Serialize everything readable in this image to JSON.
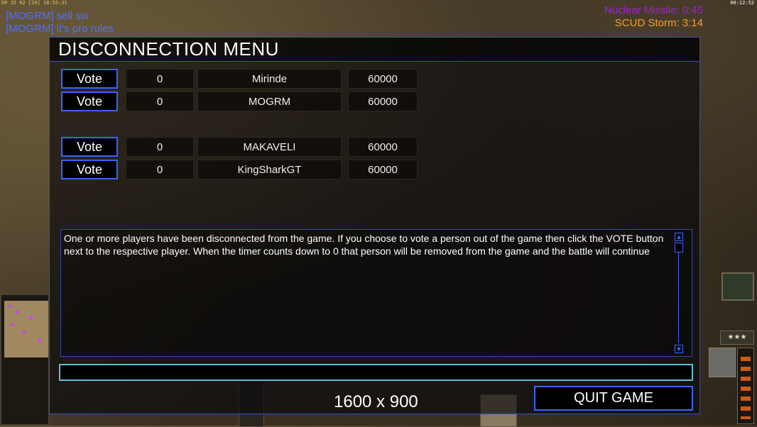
{
  "hud": {
    "top_left_stats": "DR 35 62 [20] 18:55:31",
    "top_right_clock": "00:12:52"
  },
  "chat": {
    "messages": [
      {
        "text": "[MOGRM] sell sw"
      },
      {
        "text": "[MOGRM] it's pro rules"
      }
    ]
  },
  "timers": {
    "nuclear": "Nuclear Missile: 0:45",
    "scud": "SCUD Storm: 3:14"
  },
  "colors": {
    "accent_blue": "#3a64ff",
    "input_border": "#5fc0d0",
    "nuclear_timer": "#a020d0",
    "scud_timer": "#f0a030"
  },
  "dialog": {
    "title": "DISCONNECTION MENU",
    "players": [
      {
        "vote_label": "Vote",
        "votes": "0",
        "name": "Mirinde",
        "timer": "60000"
      },
      {
        "vote_label": "Vote",
        "votes": "0",
        "name": "MOGRM",
        "timer": "60000"
      },
      {
        "vote_label": "Vote",
        "votes": "0",
        "name": "MAKAVELI",
        "timer": "60000"
      },
      {
        "vote_label": "Vote",
        "votes": "0",
        "name": "KingSharkGT",
        "timer": "60000"
      }
    ],
    "message": "One or more players have been disconnected from the game. If you choose to vote a person out of the game then click the VOTE button next to the respective player. When the timer counts down to 0 that person will be removed from the game and the battle will continue",
    "chat_input_value": "",
    "resolution": "1600 x 900",
    "quit_label": "QUIT GAME"
  },
  "side_hud": {
    "rank_stars": "★★★"
  }
}
